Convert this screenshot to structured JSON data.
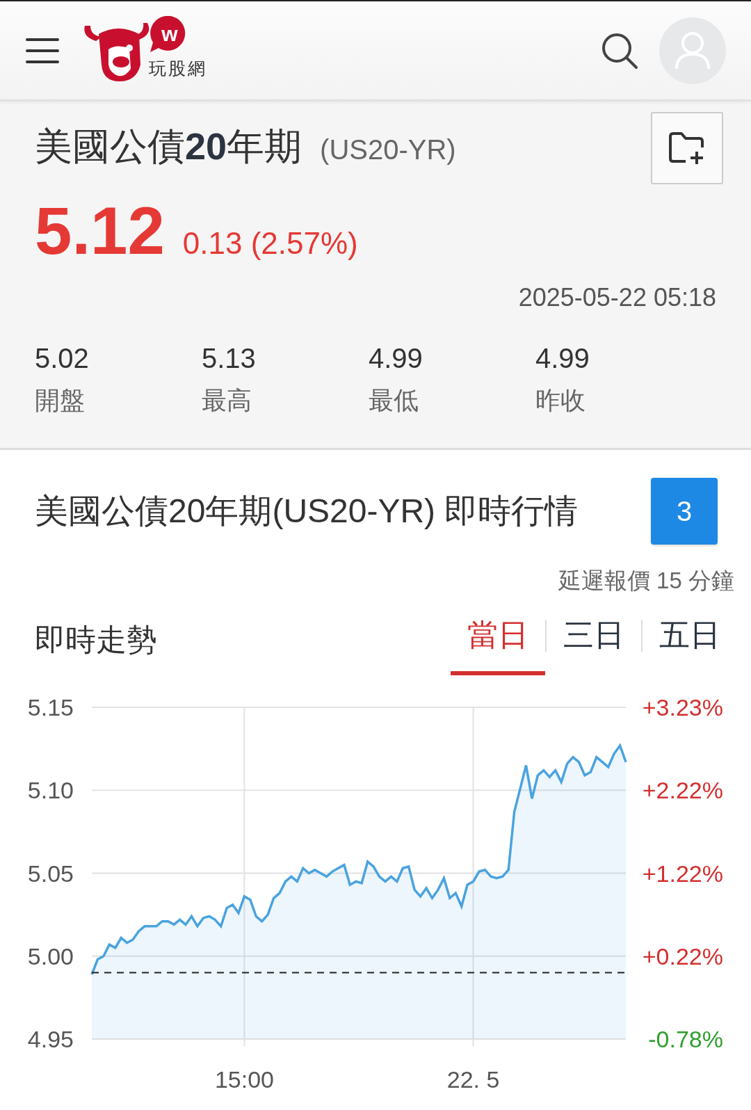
{
  "header": {
    "logo_mark": "w",
    "logo_text": "玩股網"
  },
  "quote": {
    "title": "美國公債**20**年期",
    "symbol": "(US20-YR)",
    "price": "5.12",
    "change": "0.13 (2.57%)",
    "timestamp": "2025-05-22 05:18",
    "stats": [
      {
        "value": "5.02",
        "label": "開盤"
      },
      {
        "value": "5.13",
        "label": "最高"
      },
      {
        "value": "4.99",
        "label": "最低"
      },
      {
        "value": "4.99",
        "label": "昨收"
      }
    ]
  },
  "realtime": {
    "heading": "美國公債20年期(US20-YR) 即時行情",
    "badge": "3",
    "delay_note": "延遲報價 15 分鐘",
    "chart_title": "即時走勢",
    "tabs": [
      {
        "label": "當日",
        "selected": true
      },
      {
        "label": "三日",
        "selected": false
      },
      {
        "label": "五日",
        "selected": false
      }
    ],
    "right_axis_labels": [
      {
        "label": "+3.23%",
        "color": "#d32f2f"
      },
      {
        "label": "+2.22%",
        "color": "#d32f2f"
      },
      {
        "label": "+1.22%",
        "color": "#d32f2f"
      },
      {
        "label": "+0.22%",
        "color": "#d32f2f"
      },
      {
        "label": "-0.78%",
        "color": "#2e9e2e"
      }
    ],
    "chart_data": {
      "type": "area",
      "grid": true,
      "ref_lines": [
        {
          "axis": "y",
          "value": 4.99
        }
      ],
      "ylim": [
        4.95,
        5.15
      ],
      "yticks": [
        {
          "value": 5.15,
          "label": "5.15"
        },
        {
          "value": 5.1,
          "label": "5.10"
        },
        {
          "value": 5.05,
          "label": "5.05"
        },
        {
          "value": 5.0,
          "label": "5.00"
        },
        {
          "value": 4.95,
          "label": "4.95"
        }
      ],
      "categories": [
        null,
        null,
        null,
        null,
        null,
        null,
        null,
        null,
        null,
        null,
        null,
        null,
        null,
        null,
        null,
        null,
        null,
        null,
        null,
        null,
        null,
        null,
        null,
        null,
        null,
        null,
        "15:00",
        null,
        null,
        null,
        null,
        null,
        null,
        null,
        null,
        null,
        null,
        null,
        null,
        null,
        null,
        null,
        null,
        null,
        null,
        null,
        null,
        null,
        null,
        null,
        null,
        null,
        null,
        null,
        null,
        null,
        null,
        null,
        null,
        null,
        null,
        null,
        null,
        null,
        null,
        "22. 5",
        null,
        null,
        null,
        null,
        null,
        null,
        null,
        null,
        null,
        null,
        null,
        null,
        null,
        null,
        null,
        null,
        null,
        null,
        null,
        null,
        null,
        null,
        null,
        null,
        null,
        null
      ],
      "series": [
        {
          "color": "#4aa3df",
          "values": [
            4.989,
            4.998,
            5.0,
            5.007,
            5.005,
            5.011,
            5.008,
            5.01,
            5.015,
            5.018,
            5.018,
            5.018,
            5.021,
            5.021,
            5.019,
            5.022,
            5.019,
            5.024,
            5.018,
            5.023,
            5.024,
            5.022,
            5.018,
            5.029,
            5.031,
            5.026,
            5.036,
            5.034,
            5.024,
            5.021,
            5.025,
            5.035,
            5.038,
            5.045,
            5.048,
            5.045,
            5.053,
            5.05,
            5.052,
            5.05,
            5.048,
            5.051,
            5.053,
            5.055,
            5.043,
            5.045,
            5.044,
            5.057,
            5.054,
            5.048,
            5.045,
            5.048,
            5.045,
            5.053,
            5.054,
            5.04,
            5.036,
            5.041,
            5.035,
            5.04,
            5.047,
            5.035,
            5.038,
            5.03,
            5.043,
            5.045,
            5.051,
            5.052,
            5.048,
            5.047,
            5.048,
            5.052,
            5.087,
            5.101,
            5.115,
            5.095,
            5.109,
            5.112,
            5.108,
            5.112,
            5.105,
            5.116,
            5.12,
            5.117,
            5.109,
            5.111,
            5.12,
            5.117,
            5.114,
            5.122,
            5.127,
            5.117
          ]
        }
      ]
    }
  }
}
